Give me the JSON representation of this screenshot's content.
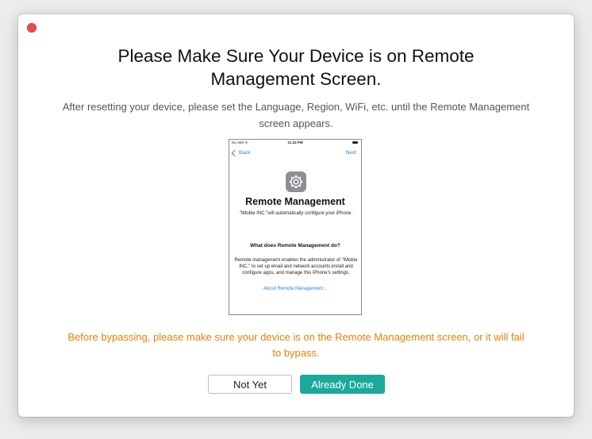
{
  "dialog": {
    "title": "Please Make Sure Your Device is on Remote Management Screen.",
    "subtitle": "After resetting your device, please set the Language, Region, WiFi, etc. until the Remote Management screen appears.",
    "warning": "Before bypassing, please make sure your device is on the Remote Management screen, or it will fail to bypass.",
    "buttons": {
      "not_yet": "Not Yet",
      "already_done": "Already Done"
    },
    "colors": {
      "warning": "#f07d0a",
      "primary_button": "#1aa99a",
      "close_dot": "#ee4a4a",
      "phone_link": "#2f80ed"
    }
  },
  "phone_preview": {
    "status": {
      "carrier": "No SIM",
      "time": "11:43 PM"
    },
    "nav": {
      "back": "Back",
      "next": "Next"
    },
    "icon": "gear-icon",
    "heading": "Remote Management",
    "org_text": "\"iMobie INC.\"will automatically configure your iPhone.",
    "question": "What does Remote Management do?",
    "description": "Remote management enables the administrator of \"iMobie INC.\" to set up email and network accounts,install and configure apps, and manage this iPhone's settings.",
    "link": "About Remote Management..."
  }
}
